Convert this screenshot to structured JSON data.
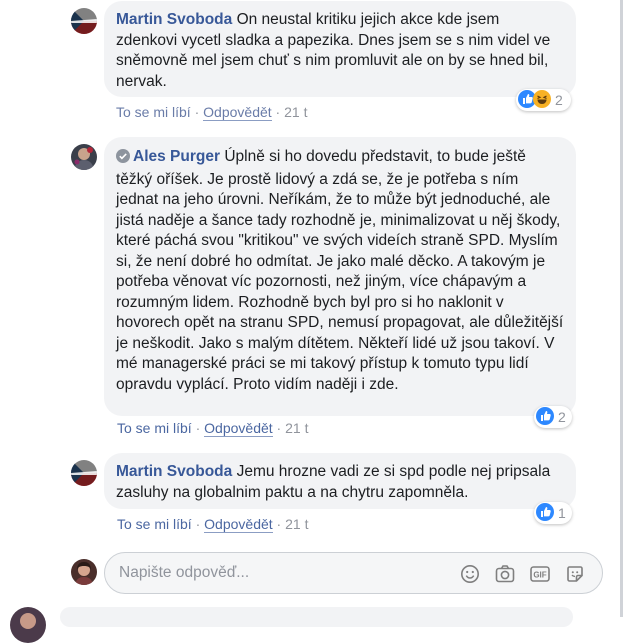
{
  "comments": [
    {
      "author": "Martin Svoboda",
      "text": "On neustal kritiku jejich akce kde jsem zdenkovi vycetl sladka a papezika. Dnes jsem se s nim videl ve sněmovně mel jsem chuť s nim promluvit ale on by se hned bil, nervak.",
      "like_label": "To se mi líbí",
      "reply_label": "Odpovědět",
      "separator": "·",
      "time": "21 t",
      "reaction_count": "2",
      "reactions": [
        "like",
        "haha"
      ]
    },
    {
      "author": "Ales Purger",
      "text": "Úplně si ho dovedu představit, to bude ještě těžký oříšek. Je prostě lidový a zdá se, že je potřeba s ním jednat na jeho úrovni. Neříkám, že to může být jednoduché, ale jistá naděje a šance tady rozhodně je, minimalizovat u něj škody, které páchá svou \"kritikou\" ve svých videích straně SPD. Myslím si, že není dobré ho odmítat. Je jako malé děcko. A takovým je potřeba věnovat víc pozornosti, než jiným, více chápavým a rozumným lidem. Rozhodně bych byl pro si ho naklonit v hovorech opět na stranu SPD, nemusí propagovat, ale důležitější je neškodit. Jako s malým dítětem. Někteří lidé už jsou takoví. V mé managerské práci se mi takový přístup k tomuto typu lidí opravdu vyplácí. Proto vidím naději i zde.",
      "like_label": "To se mi líbí",
      "reply_label": "Odpovědět",
      "separator": "·",
      "time": "21 t",
      "reaction_count": "2",
      "reactions": [
        "like"
      ]
    },
    {
      "author": "Martin Svoboda",
      "text": "Jemu hrozne vadi ze si spd podle nej pripsala zasluhy na globalnim paktu a na chytru zapomněla.",
      "like_label": "To se mi líbí",
      "reply_label": "Odpovědět",
      "separator": "·",
      "time": "21 t",
      "reaction_count": "1",
      "reactions": [
        "like"
      ]
    }
  ],
  "composer": {
    "placeholder": "Napište odpověď...",
    "tools": [
      "emoji-icon",
      "camera-icon",
      "gif-icon",
      "sticker-icon"
    ]
  },
  "colors": {
    "author": "#385898",
    "bubble": "#f2f3f5",
    "like_blue": "#2d88ff",
    "haha_yellow": "#f7b125"
  }
}
